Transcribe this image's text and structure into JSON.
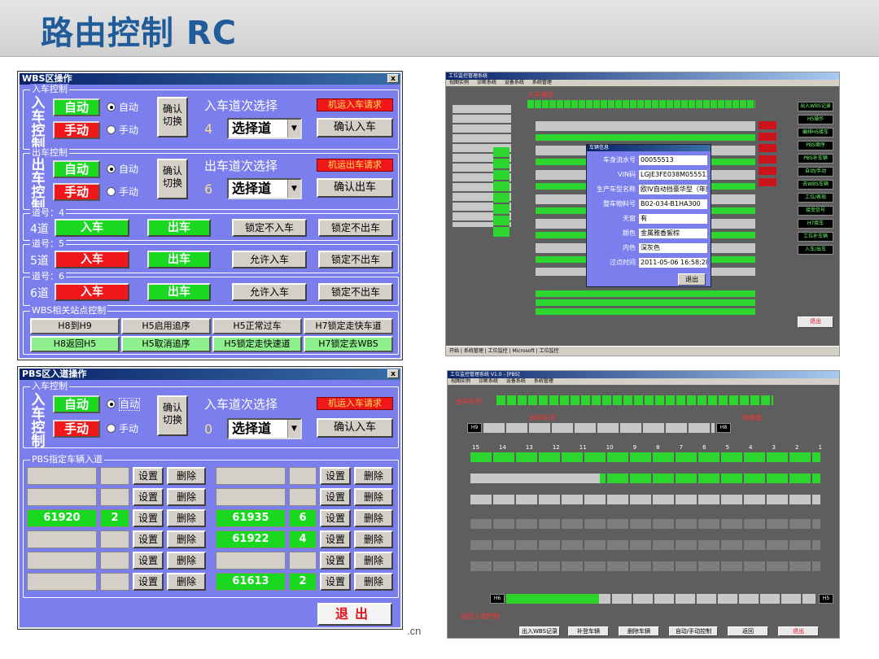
{
  "slide": {
    "title": "路由控制 RC",
    "footer": ".cn"
  },
  "wbs_window": {
    "title": "WBS区操作",
    "close": "x",
    "entry": {
      "group_label": "入车控制",
      "vertical_label": "入车控制",
      "auto": "自动",
      "manual": "手动",
      "radio_auto": "自动",
      "radio_manual": "手动",
      "confirm_switch": "确认切换",
      "seq_label": "入车道次选择",
      "seq_num": "4",
      "select_label": "选择道",
      "request": "机运入车请求",
      "confirm": "确认入车"
    },
    "exit": {
      "group_label": "出车控制",
      "vertical_label": "出车控制",
      "auto": "自动",
      "manual": "手动",
      "radio_auto": "自动",
      "radio_manual": "手动",
      "confirm_switch": "确认切换",
      "seq_label": "出车道次选择",
      "seq_num": "6",
      "select_label": "选择道",
      "request": "机运出车请求",
      "confirm": "确认出车"
    },
    "lanes": [
      {
        "group_label": "道号：4",
        "name": "4道",
        "in": "入车",
        "out": "出车",
        "in_color": "green",
        "out_color": "green",
        "btn1": "锁定不入车",
        "btn2": "锁定不出车"
      },
      {
        "group_label": "道号：5",
        "name": "5道",
        "in": "入车",
        "out": "出车",
        "in_color": "red",
        "out_color": "green",
        "btn1": "允许入车",
        "btn2": "锁定不出车"
      },
      {
        "group_label": "道号：6",
        "name": "6道",
        "in": "入车",
        "out": "出车",
        "in_color": "red",
        "out_color": "green",
        "btn1": "允许入车",
        "btn2": "锁定不出车"
      }
    ],
    "station": {
      "group_label": "WBS相关站点控制",
      "row1": [
        "H8到H9",
        "H5启用追序",
        "H5正常过车",
        "H7锁定走快车道"
      ],
      "row2": [
        "H8返回H5",
        "H5取消追序",
        "H5锁定走快速道",
        "H7锁定去WBS"
      ]
    }
  },
  "pbs_window": {
    "title": "PBS区入道操作",
    "close": "x",
    "entry": {
      "group_label": "入车控制",
      "vertical_label": "入车控制",
      "auto": "自动",
      "manual": "手动",
      "radio_auto": "自动",
      "radio_manual": "手动",
      "confirm_switch": "确认切换",
      "seq_label": "入车道次选择",
      "seq_num": "0",
      "select_label": "选择道",
      "request": "机运入车请求",
      "confirm": "确认入车"
    },
    "assign_label": "PBS指定车辆入道",
    "set": "设置",
    "del": "删除",
    "left_rows": [
      {
        "car": "",
        "lane": ""
      },
      {
        "car": "",
        "lane": ""
      },
      {
        "car": "61920",
        "lane": "2"
      },
      {
        "car": "",
        "lane": ""
      },
      {
        "car": "",
        "lane": ""
      },
      {
        "car": "",
        "lane": ""
      }
    ],
    "right_rows": [
      {
        "car": "",
        "lane": ""
      },
      {
        "car": "",
        "lane": ""
      },
      {
        "car": "61935",
        "lane": "6"
      },
      {
        "car": "61922",
        "lane": "4"
      },
      {
        "car": "",
        "lane": ""
      },
      {
        "car": "61613",
        "lane": "2"
      }
    ],
    "exit": "退出"
  },
  "top_shot": {
    "title": "工位监控管理系统",
    "menu": [
      "视图实例",
      "诊断系统",
      "设备系统",
      "系统管理"
    ],
    "label_top": "入车请求",
    "side_buttons": [
      "出入WBS记录",
      "H5操作",
      "编排H5接车",
      "PBS顺序",
      "PBS补车辆",
      "自动/手动",
      "去WBS车辆",
      "工位/表现",
      "接受信号",
      "H7接车",
      "工位补车辆",
      "入车/出车"
    ],
    "exit": "退出",
    "dialog": {
      "title": "车辆信息",
      "rows": [
        {
          "label": "车身流水号",
          "value": "00055513"
        },
        {
          "label": "VIN码",
          "value": "LGJE3FE038M055513"
        },
        {
          "label": "生产车型名称",
          "value": "欧IV自动挡豪华型（年款）"
        },
        {
          "label": "整车物料号",
          "value": "B02-034-B1HA300"
        },
        {
          "label": "天窗",
          "value": "有"
        },
        {
          "label": "颜色",
          "value": "金属雅香絮棕"
        },
        {
          "label": "内色",
          "value": "深灰色"
        },
        {
          "label": "过点时间",
          "value": "2011-05-06 16:58:28"
        }
      ],
      "button": "退出"
    },
    "taskbar": "开始 | 系统管理 | 工位监控 | Microsoft | 工位监控"
  },
  "bottom_shot": {
    "title": "工位监控管理系统 V1.0 - [PBS]",
    "menu": [
      "视图实例",
      "诊断系统",
      "设备系统",
      "系统管理"
    ],
    "label_left": "出车队列",
    "label_mid": "出车队列",
    "label_right": "快速道",
    "label_bottom": "返回入道控制",
    "h_labels": [
      "H9",
      "H8",
      "H6",
      "H5"
    ],
    "lane_numbers": [
      "15",
      "14",
      "13",
      "12",
      "11",
      "10",
      "9",
      "8",
      "7",
      "6",
      "5",
      "4",
      "3",
      "2",
      "1"
    ],
    "buttons": [
      "出入WBS记录",
      "补登车辆",
      "删除车辆",
      "自动/手动控制",
      "返回",
      "退出"
    ]
  }
}
